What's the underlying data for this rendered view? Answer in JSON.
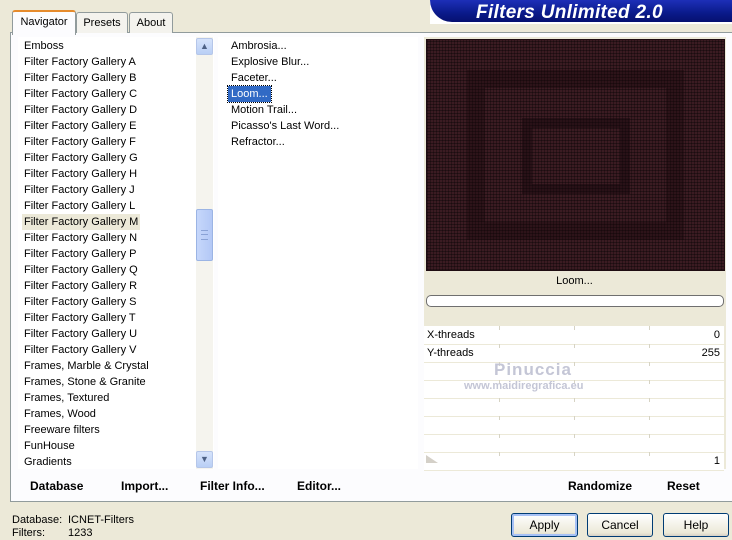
{
  "header": {
    "title": "Filters Unlimited 2.0"
  },
  "tabs": [
    {
      "label": "Navigator",
      "active": true
    },
    {
      "label": "Presets",
      "active": false
    },
    {
      "label": "About",
      "active": false
    }
  ],
  "categories": {
    "items": [
      "Emboss",
      "Filter Factory Gallery A",
      "Filter Factory Gallery B",
      "Filter Factory Gallery C",
      "Filter Factory Gallery D",
      "Filter Factory Gallery E",
      "Filter Factory Gallery F",
      "Filter Factory Gallery G",
      "Filter Factory Gallery H",
      "Filter Factory Gallery J",
      "Filter Factory Gallery L",
      "Filter Factory Gallery M",
      "Filter Factory Gallery N",
      "Filter Factory Gallery P",
      "Filter Factory Gallery Q",
      "Filter Factory Gallery R",
      "Filter Factory Gallery S",
      "Filter Factory Gallery T",
      "Filter Factory Gallery U",
      "Filter Factory Gallery V",
      "Frames, Marble & Crystal",
      "Frames, Stone & Granite",
      "Frames, Textured",
      "Frames, Wood",
      "Freeware filters",
      "FunHouse",
      "Gradients"
    ],
    "selected": "Filter Factory Gallery M"
  },
  "filters": {
    "items": [
      "Ambrosia...",
      "Explosive Blur...",
      "Faceter...",
      "Loom...",
      "Motion Trail...",
      "Picasso's Last Word...",
      "Refractor..."
    ],
    "selected": "Loom..."
  },
  "preview": {
    "filter_name": "Loom..."
  },
  "params": [
    {
      "label": "X-threads",
      "value": "0"
    },
    {
      "label": "Y-threads",
      "value": "255"
    },
    {
      "label": "",
      "value": ""
    },
    {
      "label": "",
      "value": ""
    },
    {
      "label": "",
      "value": ""
    },
    {
      "label": "",
      "value": ""
    },
    {
      "label": "",
      "value": ""
    },
    {
      "label": "",
      "value": "1"
    }
  ],
  "watermark": {
    "name": "Pinuccia",
    "url": "www.maidiregrafica.eu"
  },
  "bottom_links": {
    "database": "Database",
    "import": "Import...",
    "filter_info": "Filter Info...",
    "editor": "Editor...",
    "randomize": "Randomize",
    "reset": "Reset"
  },
  "status": {
    "database_label": "Database:",
    "database_value": "ICNET-Filters",
    "filters_label": "Filters:",
    "filters_value": "1233"
  },
  "buttons": {
    "apply": "Apply",
    "cancel": "Cancel",
    "help": "Help"
  },
  "colors": {
    "accent_selection": "#316ac5",
    "header": "#0a1a8a",
    "preview_bg": "#3b1b22"
  }
}
